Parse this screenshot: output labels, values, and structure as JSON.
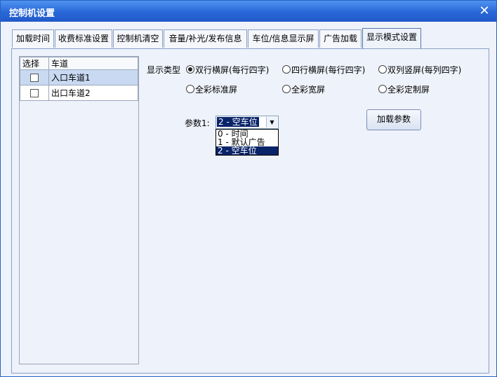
{
  "window": {
    "title": "控制机设置",
    "close_glyph": "✕"
  },
  "tabs": [
    {
      "label": "加载时间"
    },
    {
      "label": "收费标准设置"
    },
    {
      "label": "控制机清空"
    },
    {
      "label": "音量/补光/发布信息"
    },
    {
      "label": "车位/信息显示屏"
    },
    {
      "label": "广告加载"
    },
    {
      "label": "显示模式设置",
      "active": true
    }
  ],
  "lanes": {
    "header_select": "选择",
    "header_lane": "车道",
    "rows": [
      {
        "name": "入口车道1",
        "checked": false,
        "selected": true
      },
      {
        "name": "出口车道2",
        "checked": false,
        "selected": false
      }
    ]
  },
  "display_type": {
    "label": "显示类型",
    "options": [
      {
        "label": "双行横屏(每行四字)",
        "checked": true
      },
      {
        "label": "四行横屏(每行四字)",
        "checked": false
      },
      {
        "label": "双列竖屏(每列四字)",
        "checked": false
      },
      {
        "label": "全彩标准屏",
        "checked": false
      },
      {
        "label": "全彩宽屏",
        "checked": false
      },
      {
        "label": "全彩定制屏",
        "checked": false
      }
    ]
  },
  "param1": {
    "label": "参数1:",
    "value": "2 - 空车位",
    "options": [
      "0 - 时间",
      "1 - 默认广告",
      "2 - 空车位"
    ],
    "selected_index": 2
  },
  "load_button": {
    "label": "加载参数"
  },
  "colors": {
    "titlebar": "#2867d8",
    "selection": "#0a246a",
    "row_selected": "#c9d9f2"
  }
}
